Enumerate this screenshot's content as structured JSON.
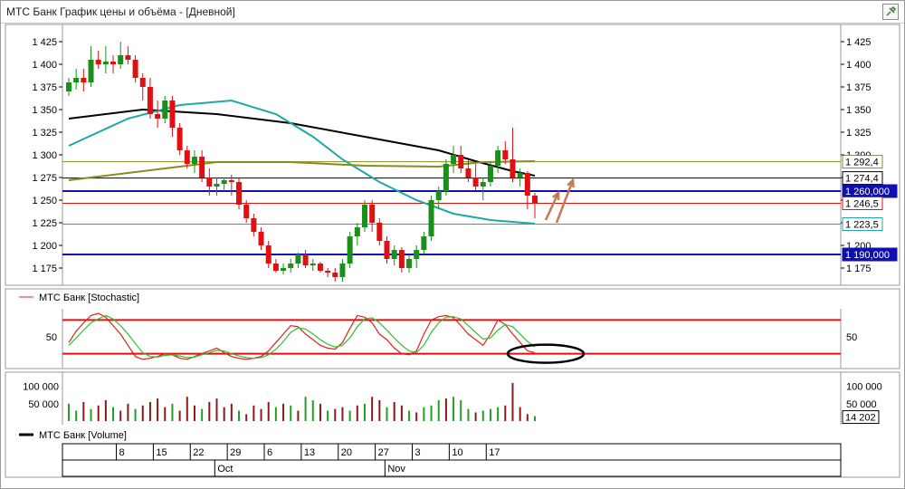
{
  "window": {
    "title": "МТС Банк График цены и объёма - [Дневной]"
  },
  "colors": {
    "up": "#1a8f1a",
    "down": "#e01010",
    "volume_up": "#22a022",
    "volume_down": "#8b1a1a",
    "level_blue": "#1010b0",
    "ma_black": "#000000",
    "ma_teal": "#20a8a8",
    "ma_olive": "#8a8a20",
    "stoch_k": "#e02020",
    "stoch_d": "#30c030",
    "annotation": "#c87850"
  },
  "chart_data": [
    {
      "type": "candlestick",
      "name": "price",
      "ylim": [
        1160,
        1440
      ],
      "y_ticks": [
        "1 425",
        "1 400",
        "1 375",
        "1 350",
        "1 325",
        "1 300",
        "1 275",
        "1 250",
        "1 225",
        "1 200",
        "1 175"
      ],
      "ohlc": [
        [
          1370,
          1385,
          1365,
          1380
        ],
        [
          1380,
          1395,
          1372,
          1385
        ],
        [
          1385,
          1395,
          1370,
          1380
        ],
        [
          1380,
          1420,
          1375,
          1405
        ],
        [
          1405,
          1415,
          1395,
          1400
        ],
        [
          1400,
          1420,
          1390,
          1403
        ],
        [
          1403,
          1410,
          1390,
          1400
        ],
        [
          1400,
          1425,
          1395,
          1410
        ],
        [
          1410,
          1420,
          1400,
          1405
        ],
        [
          1405,
          1410,
          1380,
          1385
        ],
        [
          1385,
          1390,
          1360,
          1375
        ],
        [
          1375,
          1385,
          1340,
          1345
        ],
        [
          1345,
          1360,
          1330,
          1340
        ],
        [
          1340,
          1365,
          1335,
          1360
        ],
        [
          1360,
          1365,
          1320,
          1330
        ],
        [
          1330,
          1335,
          1300,
          1305
        ],
        [
          1305,
          1310,
          1285,
          1290
        ],
        [
          1290,
          1305,
          1280,
          1298
        ],
        [
          1298,
          1305,
          1270,
          1275
        ],
        [
          1275,
          1285,
          1255,
          1265
        ],
        [
          1265,
          1275,
          1255,
          1268
        ],
        [
          1268,
          1275,
          1260,
          1272
        ],
        [
          1272,
          1278,
          1255,
          1270
        ],
        [
          1270,
          1275,
          1240,
          1245
        ],
        [
          1245,
          1250,
          1225,
          1230
        ],
        [
          1230,
          1235,
          1210,
          1215
        ],
        [
          1215,
          1220,
          1195,
          1200
        ],
        [
          1200,
          1205,
          1175,
          1180
        ],
        [
          1180,
          1185,
          1170,
          1172
        ],
        [
          1172,
          1180,
          1168,
          1175
        ],
        [
          1175,
          1185,
          1170,
          1180
        ],
        [
          1180,
          1192,
          1175,
          1190
        ],
        [
          1190,
          1195,
          1175,
          1178
        ],
        [
          1178,
          1185,
          1172,
          1180
        ],
        [
          1180,
          1182,
          1170,
          1172
        ],
        [
          1172,
          1175,
          1165,
          1170
        ],
        [
          1170,
          1175,
          1160,
          1165
        ],
        [
          1165,
          1185,
          1160,
          1180
        ],
        [
          1180,
          1215,
          1175,
          1210
        ],
        [
          1210,
          1225,
          1200,
          1220
        ],
        [
          1220,
          1250,
          1215,
          1245
        ],
        [
          1245,
          1250,
          1215,
          1225
        ],
        [
          1225,
          1230,
          1200,
          1205
        ],
        [
          1205,
          1210,
          1180,
          1185
        ],
        [
          1185,
          1200,
          1178,
          1195
        ],
        [
          1195,
          1198,
          1170,
          1175
        ],
        [
          1175,
          1190,
          1170,
          1185
        ],
        [
          1185,
          1200,
          1175,
          1195
        ],
        [
          1195,
          1215,
          1190,
          1210
        ],
        [
          1210,
          1255,
          1205,
          1250
        ],
        [
          1250,
          1265,
          1240,
          1260
        ],
        [
          1260,
          1295,
          1255,
          1290
        ],
        [
          1290,
          1310,
          1280,
          1300
        ],
        [
          1300,
          1310,
          1280,
          1285
        ],
        [
          1285,
          1295,
          1270,
          1275
        ],
        [
          1275,
          1290,
          1260,
          1265
        ],
        [
          1265,
          1275,
          1250,
          1270
        ],
        [
          1270,
          1292,
          1265,
          1288
        ],
        [
          1288,
          1310,
          1280,
          1305
        ],
        [
          1305,
          1315,
          1290,
          1295
        ],
        [
          1295,
          1330,
          1270,
          1275
        ],
        [
          1275,
          1285,
          1265,
          1280
        ],
        [
          1280,
          1282,
          1240,
          1255
        ],
        [
          1255,
          1258,
          1230,
          1246
        ]
      ],
      "moving_averages": [
        {
          "color": "ma_black",
          "values": [
            [
              0,
              1340
            ],
            [
              10,
              1350
            ],
            [
              20,
              1345
            ],
            [
              30,
              1335
            ],
            [
              40,
              1320
            ],
            [
              50,
              1305
            ],
            [
              55,
              1293
            ],
            [
              60,
              1282
            ],
            [
              63,
              1277
            ]
          ]
        },
        {
          "color": "ma_teal",
          "values": [
            [
              0,
              1310
            ],
            [
              8,
              1340
            ],
            [
              15,
              1355
            ],
            [
              22,
              1360
            ],
            [
              28,
              1345
            ],
            [
              33,
              1320
            ],
            [
              37,
              1295
            ],
            [
              42,
              1270
            ],
            [
              47,
              1250
            ],
            [
              52,
              1235
            ],
            [
              57,
              1228
            ],
            [
              63,
              1224
            ]
          ]
        },
        {
          "color": "ma_olive",
          "values": [
            [
              0,
              1272
            ],
            [
              10,
              1282
            ],
            [
              20,
              1292
            ],
            [
              30,
              1292
            ],
            [
              40,
              1288
            ],
            [
              50,
              1287
            ],
            [
              56,
              1292
            ],
            [
              63,
              1293
            ]
          ]
        }
      ],
      "horizontal_levels": [
        {
          "value": 1260,
          "color": "level_blue",
          "label": "1 260,000"
        },
        {
          "value": 1190,
          "color": "level_blue",
          "label": "1 190,000"
        },
        {
          "value": 1292.4,
          "color": "ma_olive",
          "label": "1 292,4"
        },
        {
          "value": 1274.4,
          "color": "ma_black",
          "label": "1 274,4"
        },
        {
          "value": 1246.5,
          "color": "down",
          "label": "1 246,5"
        },
        {
          "value": 1223.5,
          "color": "ma_teal",
          "label": "1 223,5"
        }
      ],
      "annotations": [
        "two upward arrows after last candle"
      ]
    },
    {
      "type": "line",
      "name": "stochastic",
      "legend": "МТС Банк [Stochastic]",
      "ylim": [
        0,
        100
      ],
      "y_ticks": [
        "50"
      ],
      "levels": [
        80,
        20
      ],
      "series": [
        {
          "color": "stoch_k",
          "values": [
            40,
            60,
            75,
            88,
            92,
            85,
            70,
            55,
            35,
            15,
            10,
            12,
            15,
            20,
            18,
            12,
            10,
            15,
            20,
            25,
            30,
            22,
            15,
            12,
            10,
            12,
            15,
            25,
            40,
            55,
            70,
            68,
            55,
            45,
            35,
            30,
            28,
            40,
            65,
            88,
            85,
            75,
            55,
            45,
            30,
            20,
            18,
            25,
            55,
            80,
            86,
            88,
            84,
            70,
            55,
            45,
            35,
            55,
            80,
            72,
            55,
            40,
            25,
            22
          ]
        },
        {
          "color": "stoch_d",
          "values": [
            35,
            48,
            62,
            75,
            82,
            88,
            82,
            70,
            55,
            38,
            22,
            15,
            14,
            17,
            18,
            16,
            13,
            14,
            18,
            22,
            26,
            25,
            20,
            16,
            13,
            12,
            13,
            18,
            28,
            42,
            58,
            66,
            64,
            55,
            45,
            37,
            32,
            35,
            48,
            68,
            82,
            84,
            75,
            62,
            48,
            35,
            25,
            22,
            35,
            58,
            75,
            85,
            86,
            82,
            70,
            58,
            46,
            48,
            62,
            72,
            68,
            55,
            42,
            32
          ]
        }
      ],
      "annotations": [
        "ellipse highlighting oversold zone"
      ]
    },
    {
      "type": "bar",
      "name": "volume",
      "legend": "МТС Банк [Volume]",
      "ylim": [
        0,
        120000
      ],
      "y_ticks": [
        "100 000",
        "50 000"
      ],
      "last_value_label": "14 202",
      "values": [
        [
          50000,
          1
        ],
        [
          30000,
          1
        ],
        [
          55000,
          0
        ],
        [
          35000,
          1
        ],
        [
          45000,
          0
        ],
        [
          60000,
          0
        ],
        [
          40000,
          1
        ],
        [
          30000,
          0
        ],
        [
          50000,
          0
        ],
        [
          35000,
          1
        ],
        [
          45000,
          0
        ],
        [
          55000,
          0
        ],
        [
          65000,
          0
        ],
        [
          40000,
          0
        ],
        [
          50000,
          1
        ],
        [
          30000,
          0
        ],
        [
          70000,
          0
        ],
        [
          45000,
          0
        ],
        [
          35000,
          1
        ],
        [
          55000,
          0
        ],
        [
          65000,
          0
        ],
        [
          40000,
          0
        ],
        [
          50000,
          0
        ],
        [
          30000,
          1
        ],
        [
          20000,
          0
        ],
        [
          45000,
          0
        ],
        [
          35000,
          0
        ],
        [
          55000,
          0
        ],
        [
          40000,
          1
        ],
        [
          50000,
          0
        ],
        [
          45000,
          1
        ],
        [
          30000,
          0
        ],
        [
          70000,
          1
        ],
        [
          60000,
          1
        ],
        [
          50000,
          0
        ],
        [
          30000,
          1
        ],
        [
          35000,
          0
        ],
        [
          40000,
          0
        ],
        [
          30000,
          1
        ],
        [
          45000,
          0
        ],
        [
          50000,
          1
        ],
        [
          70000,
          0
        ],
        [
          60000,
          0
        ],
        [
          40000,
          1
        ],
        [
          55000,
          0
        ],
        [
          45000,
          0
        ],
        [
          30000,
          1
        ],
        [
          25000,
          0
        ],
        [
          40000,
          1
        ],
        [
          45000,
          1
        ],
        [
          60000,
          1
        ],
        [
          65000,
          0
        ],
        [
          70000,
          1
        ],
        [
          60000,
          1
        ],
        [
          35000,
          1
        ],
        [
          25000,
          0
        ],
        [
          30000,
          1
        ],
        [
          35000,
          1
        ],
        [
          40000,
          1
        ],
        [
          45000,
          0
        ],
        [
          110000,
          0
        ],
        [
          40000,
          0
        ],
        [
          20000,
          0
        ],
        [
          14202,
          1
        ]
      ]
    }
  ],
  "x_axis": {
    "day_labels": [
      {
        "index": 3,
        "label": "8"
      },
      {
        "index": 8,
        "label": "15"
      },
      {
        "index": 13,
        "label": "22"
      },
      {
        "index": 18,
        "label": "29"
      },
      {
        "index": 23,
        "label": "6"
      },
      {
        "index": 28,
        "label": "13"
      },
      {
        "index": 33,
        "label": "20"
      },
      {
        "index": 38,
        "label": "27"
      },
      {
        "index": 43,
        "label": "3"
      },
      {
        "index": 48,
        "label": "10"
      },
      {
        "index": 53,
        "label": "17"
      }
    ],
    "month_labels": [
      {
        "index": 19,
        "label": "Oct"
      },
      {
        "index": 42,
        "label": "Nov"
      }
    ]
  }
}
